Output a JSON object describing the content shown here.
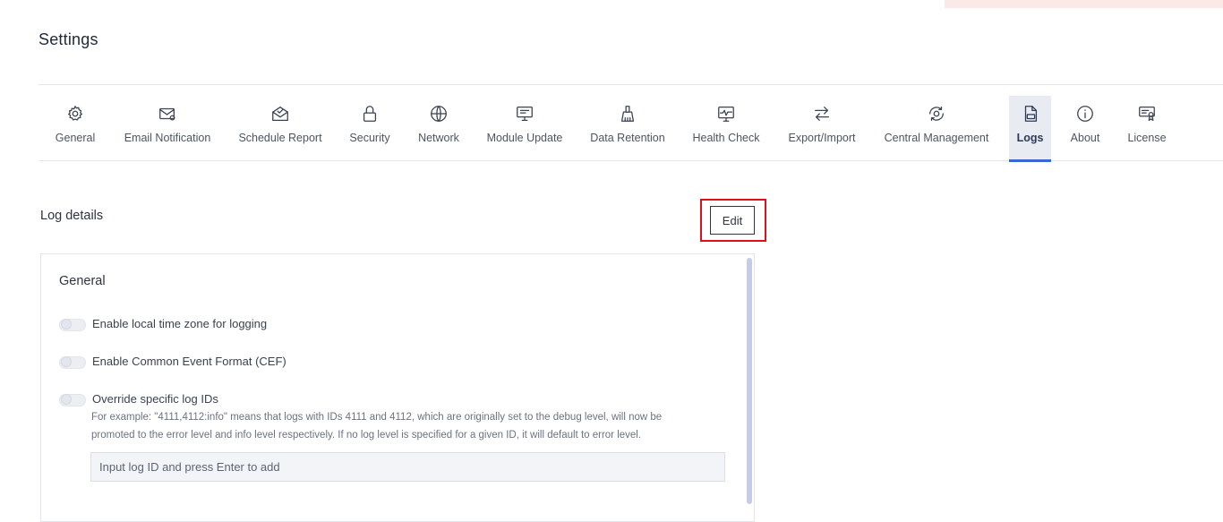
{
  "page": {
    "title": "Settings"
  },
  "tabs": [
    {
      "label": "General",
      "icon": "gear-icon",
      "active": false
    },
    {
      "label": "Email Notification",
      "icon": "envelope-icon",
      "active": false
    },
    {
      "label": "Schedule Report",
      "icon": "mail-open-icon",
      "active": false
    },
    {
      "label": "Security",
      "icon": "lock-icon",
      "active": false
    },
    {
      "label": "Network",
      "icon": "globe-icon",
      "active": false
    },
    {
      "label": "Module Update",
      "icon": "monitor-update-icon",
      "active": false
    },
    {
      "label": "Data Retention",
      "icon": "broom-icon",
      "active": false
    },
    {
      "label": "Health Check",
      "icon": "heartbeat-monitor-icon",
      "active": false
    },
    {
      "label": "Export/Import",
      "icon": "arrows-swap-icon",
      "active": false
    },
    {
      "label": "Central Management",
      "icon": "central-management-icon",
      "active": false
    },
    {
      "label": "Logs",
      "icon": "log-file-icon",
      "active": true
    },
    {
      "label": "About",
      "icon": "info-icon",
      "active": false
    },
    {
      "label": "License",
      "icon": "certificate-icon",
      "active": false
    }
  ],
  "log_details": {
    "title": "Log details",
    "edit_label": "Edit",
    "general": {
      "title": "General",
      "options": [
        {
          "label": "Enable local time zone for logging",
          "enabled": false
        },
        {
          "label": "Enable Common Event Format (CEF)",
          "enabled": false
        },
        {
          "label": "Override specific log IDs",
          "enabled": false
        }
      ],
      "help_line1": "For example: \"4111,4112:info\" means that logs with IDs 4111 and 4112, which are originally set to the debug level, will now be",
      "help_line2": "promoted to the error level and info level respectively. If no log level is specified for a given ID, it will default to error level.",
      "input_placeholder": "Input log ID and press Enter to add",
      "input_value": ""
    }
  },
  "colors": {
    "accent": "#3b66d6",
    "active_tab_bg": "#e8ebf2",
    "highlight": "#e0101a"
  }
}
